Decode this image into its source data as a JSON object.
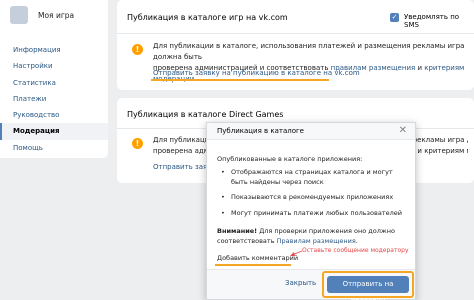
{
  "sidebar": {
    "game_title": "Моя игра",
    "items": [
      {
        "label": "Информация"
      },
      {
        "label": "Настройки"
      },
      {
        "label": "Статистика"
      },
      {
        "label": "Платежи"
      },
      {
        "label": "Руководство"
      },
      {
        "label": "Модерация"
      },
      {
        "label": "Помощь"
      }
    ],
    "active_index": 5
  },
  "vk_card": {
    "title": "Публикация в каталоге игр на vk.com",
    "sms_label": "Уведомлять по SMS",
    "info_line1": "Для публикации в каталоге, использования платежей и размещения рекламы игра должна быть",
    "info_line2_prefix": "проверена администрацией и соответствовать ",
    "rules_link": "правилам размещения",
    "info_and": " и ",
    "criteria_link": "критериям модерации",
    "info_end": ".",
    "submit_link": "Отправить заявку на публикацию в каталоге на vk.com"
  },
  "dg_card": {
    "title": "Публикация в каталоге Direct Games",
    "info_line1": "Для публикации в каталоге, использования платежей и размещения рекламы игра должна быть",
    "info_line2": "проверена администрацией и соответствовать правилам размещения и критериям модерации.",
    "submit_link": "Отправить заявку"
  },
  "modal": {
    "title": "Публикация в каталоге",
    "intro": "Опубликованные в каталоге приложения:",
    "bullets": [
      "Отображаются на страницах каталога и могут быть найдены через поиск",
      "Показываются в рекомендуемых приложениях",
      "Могут принимать платежи любых пользователей"
    ],
    "warning_bold": "Внимание!",
    "warning_text": " Для проверки приложения оно должно соответствовать ",
    "warning_link": "Правилам размещения",
    "warning_end": ".",
    "add_comment": "Добавить комментарий",
    "annotation": "Оставьте сообщение модератору",
    "cancel": "Закрыть",
    "submit": "Отправить на проверку"
  },
  "colors": {
    "accent": "#5181b8",
    "link": "#2a5885",
    "warning": "#ffa000",
    "highlight": "#f5a623",
    "annotation": "#e64646"
  }
}
